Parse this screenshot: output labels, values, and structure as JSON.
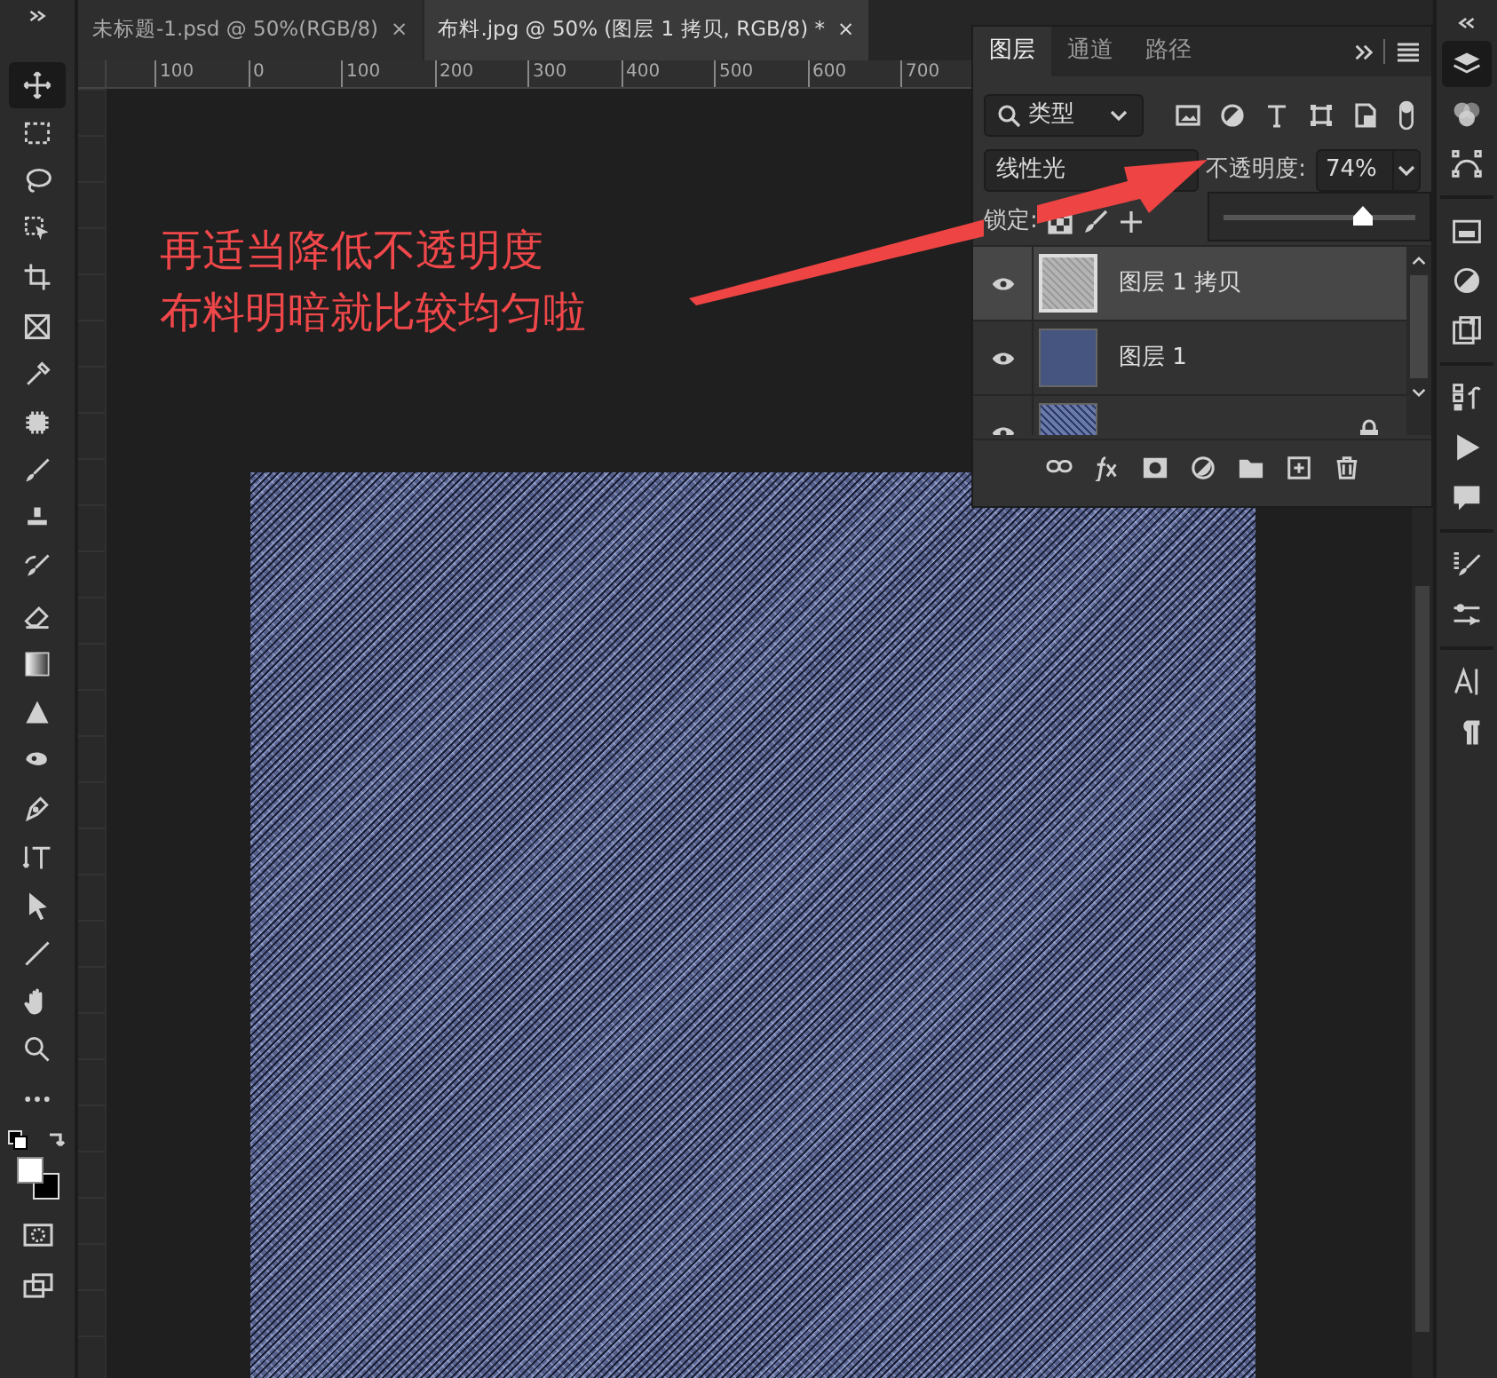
{
  "document_tabs": [
    {
      "title": "未标题-1.psd @ 50%(RGB/8)",
      "close": "×",
      "selected": false
    },
    {
      "title": "布料.jpg @ 50% (图层 1 拷贝, RGB/8) *",
      "close": "×",
      "selected": true
    }
  ],
  "ruler_labels": [
    "100",
    "0",
    "100",
    "200",
    "300",
    "400",
    "500",
    "600",
    "700"
  ],
  "tools": [
    {
      "selected": true
    },
    {
      "selected": false
    },
    {
      "selected": false
    },
    {
      "selected": false
    },
    {
      "selected": false
    },
    {
      "selected": false
    },
    {
      "selected": false
    },
    {
      "selected": false
    },
    {
      "selected": false
    },
    {
      "selected": false
    },
    {
      "selected": false
    },
    {
      "selected": false
    },
    {
      "selected": false
    },
    {
      "selected": false
    },
    {
      "selected": false
    },
    {
      "selected": false
    },
    {
      "selected": false
    },
    {
      "selected": false
    },
    {
      "selected": false
    },
    {
      "selected": false
    },
    {
      "selected": false
    },
    {
      "selected": false
    }
  ],
  "annotation": {
    "lines": [
      "再适当降低不透明度",
      "布料明暗就比较均匀啦"
    ]
  },
  "layers_panel": {
    "tabs": [
      {
        "label": "图层",
        "selected": true
      },
      {
        "label": "通道",
        "selected": false
      },
      {
        "label": "路径",
        "selected": false
      }
    ],
    "filter": {
      "value": "类型"
    },
    "blend_mode": "线性光",
    "opacity": {
      "label": "不透明度:",
      "value": "74%",
      "level": 0.72
    },
    "lock_label": "锁定:",
    "layers": [
      {
        "name": "图层 1 拷贝",
        "visible": true,
        "selected": true,
        "kind": "texture"
      },
      {
        "name": "图层 1",
        "visible": true,
        "selected": false,
        "kind": "fill"
      },
      {
        "visible": true,
        "selected": false,
        "kind": "photo",
        "locked": true
      }
    ]
  }
}
